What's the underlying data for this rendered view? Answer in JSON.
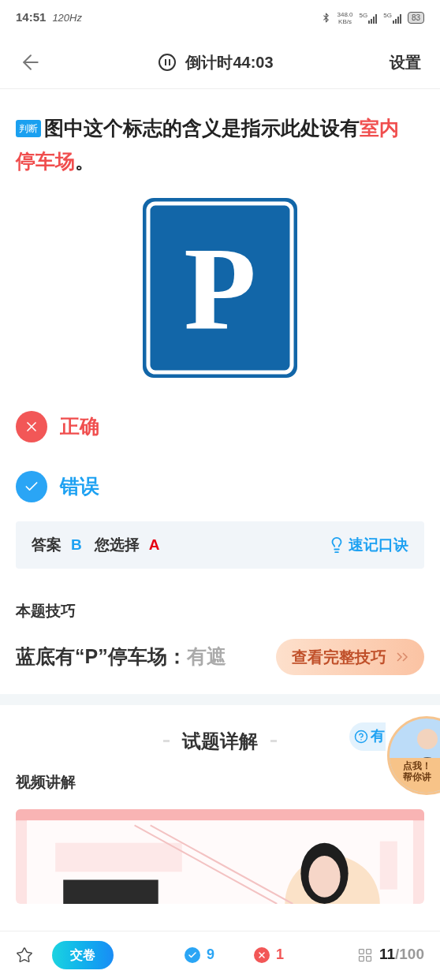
{
  "status_bar": {
    "time": "14:51",
    "refresh": "120Hz",
    "speed": "348.0",
    "speed_unit": "KB/s",
    "networks": [
      "5G",
      "5G"
    ],
    "battery": "83"
  },
  "header": {
    "countdown": "倒计时44:03",
    "settings": "设置"
  },
  "question": {
    "tag": "判断",
    "text": "图中这个标志的含义是指示此处设有",
    "highlight": "室内停车场",
    "end": "。",
    "sign_letter": "P"
  },
  "options": [
    {
      "label": "正确",
      "kind": "wrong"
    },
    {
      "label": "错误",
      "kind": "correct"
    }
  ],
  "answer": {
    "answer_label": "答案",
    "answer": "B",
    "chosen_label": "您选择",
    "chosen": "A",
    "mnemonic": "速记口诀"
  },
  "tip": {
    "title": "本题技巧",
    "text": "蓝底有“P”停车场：",
    "faded": "有遮",
    "button": "查看完整技巧"
  },
  "explain": {
    "title": "试题详解",
    "help": "有",
    "video_title": "视频讲解",
    "avatar_text": [
      "点我！",
      "帮你讲"
    ]
  },
  "bottom_bar": {
    "submit": "交卷",
    "correct": "9",
    "wrong": "1",
    "current": "11",
    "total": "/100"
  }
}
